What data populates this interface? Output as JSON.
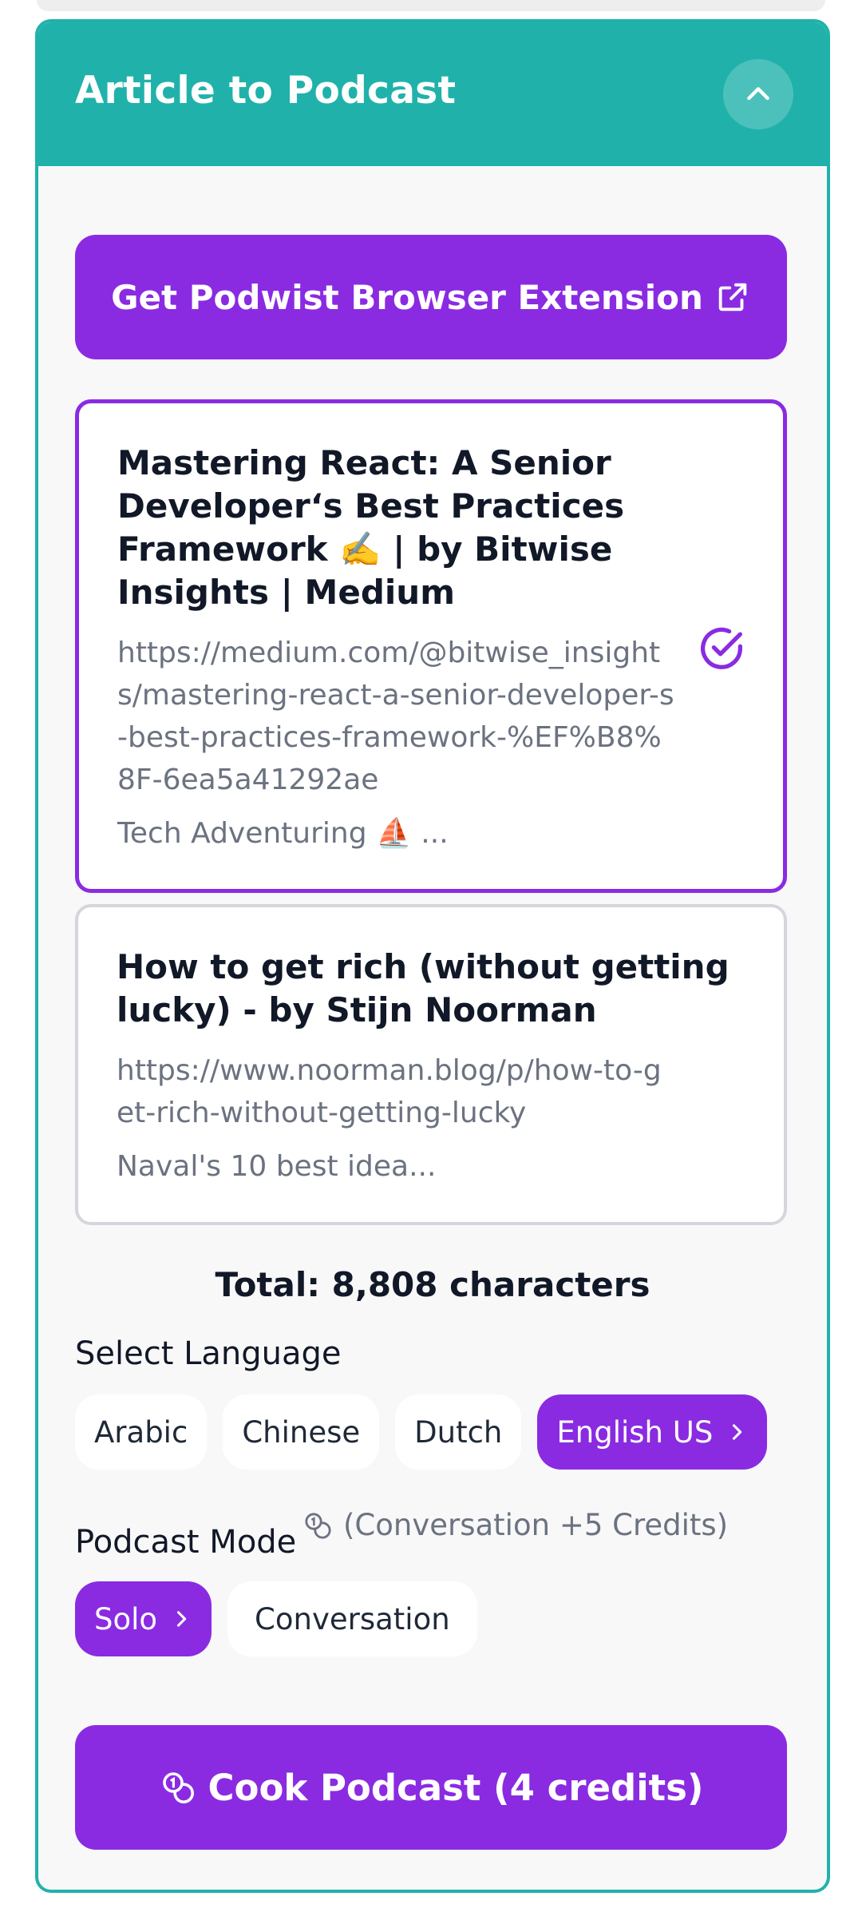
{
  "panel": {
    "title": "Article to Podcast",
    "collapse_icon": "chevron-up-icon"
  },
  "extension_button": {
    "label": "Get Podwist Browser Extension",
    "icon": "external-link-icon"
  },
  "articles": [
    {
      "title": "Mastering React: A Senior Developer‘s Best Practices Framework ✍️ | by Bitwise Insights | Medium",
      "url": "https://medium.com/@bitwise_insights/mastering-react-a-senior-developer-s-best-practices-framework-%EF%B8%8F-6ea5a41292ae",
      "description": "Tech Adventuring ⛵ ...",
      "selected": true
    },
    {
      "title": "How to get rich (without getting lucky) - by Stijn Noorman",
      "url": "https://www.noorman.blog/p/how-to-get-rich-without-getting-lucky",
      "description": "Naval's 10 best idea...",
      "selected": false
    }
  ],
  "total": "Total: 8,808 characters",
  "language": {
    "label": "Select Language",
    "options": [
      "Arabic",
      "Chinese",
      "Dutch",
      "English US"
    ],
    "selected": "English US"
  },
  "mode": {
    "label": "Podcast Mode",
    "note": "(Conversation +5 Credits)",
    "options": [
      "Solo",
      "Conversation"
    ],
    "selected": "Solo"
  },
  "cook_button": {
    "label": "Cook Podcast (4 credits)",
    "icon": "coins-icon"
  },
  "colors": {
    "accent": "#8a2be2",
    "header": "#20b2aa",
    "muted_text": "#6b7280"
  }
}
